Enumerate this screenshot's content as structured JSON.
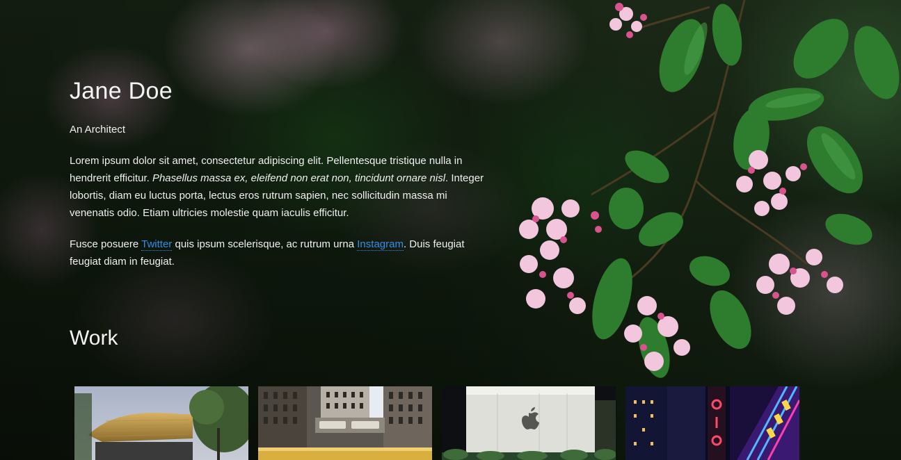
{
  "profile": {
    "name": "Jane Doe",
    "subtitle": "An Architect"
  },
  "bio": {
    "p1_start": "Lorem ipsum dolor sit amet, consectetur adipiscing elit. Pellentesque tristique nulla in hendrerit efficitur. ",
    "p1_italic": "Phasellus massa ex, eleifend non erat non, tincidunt ornare nisl",
    "p1_end": ". Integer lobortis, diam eu luctus porta, lectus eros rutrum sapien, nec sollicitudin massa mi venenatis odio. Etiam ultricies molestie quam iaculis efficitur.",
    "p2_start": "Fusce posuere ",
    "p2_link1": "Twitter",
    "p2_mid": " quis ipsum scelerisque, ac rutrum urna ",
    "p2_link2": "Instagram",
    "p2_end": ". Duis feugiat feugiat diam in feugiat."
  },
  "work": {
    "title": "Work",
    "items": [
      {
        "icon": "apple-store-building-photo"
      },
      {
        "icon": "chicago-tribune-building-photo"
      },
      {
        "icon": "apple-logo-building-photo"
      },
      {
        "icon": "neon-city-sign-photo"
      }
    ]
  },
  "colors": {
    "link": "#2f8fe8",
    "text": "#f0f0f0"
  }
}
